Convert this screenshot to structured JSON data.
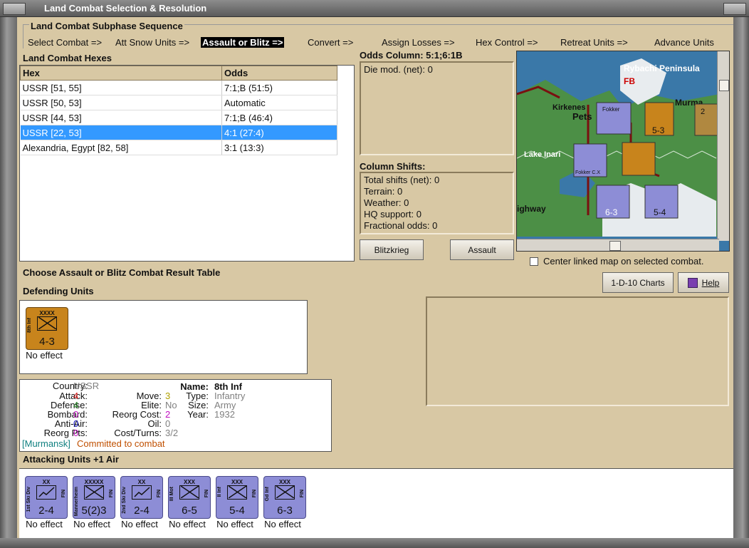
{
  "window": {
    "title": "Land Combat Selection & Resolution"
  },
  "subphase": {
    "heading": "Land Combat Subphase Sequence",
    "steps": [
      "Select Combat =>",
      "Att Snow Units =>",
      "Assault or Blitz =>",
      "Convert =>",
      "Assign Losses =>",
      "Hex Control =>",
      "Retreat Units =>",
      "Advance Units"
    ],
    "active_index": 2
  },
  "hexes": {
    "heading": "Land Combat Hexes",
    "columns": [
      "Hex",
      "Odds"
    ],
    "rows": [
      {
        "hex": "USSR [51, 55]",
        "odds": "7:1;B (51:5)"
      },
      {
        "hex": "USSR [50, 53]",
        "odds": "Automatic"
      },
      {
        "hex": "USSR [44, 53]",
        "odds": "7:1;B (46:4)"
      },
      {
        "hex": "USSR [22, 53]",
        "odds": "4:1 (27:4)"
      },
      {
        "hex": "Alexandria, Egypt [82, 58]",
        "odds": "3:1 (13:3)"
      }
    ],
    "selected_index": 3
  },
  "odds": {
    "heading": "Odds Column: 5:1;6:1B",
    "die_mod": "Die mod. (net): 0"
  },
  "shifts": {
    "heading": "Column Shifts:",
    "lines": [
      "Total shifts (net): 0",
      "Terrain: 0",
      "Weather: 0",
      "HQ support: 0",
      "Fractional odds: 0"
    ]
  },
  "buttons": {
    "blitzkrieg": "Blitzkrieg",
    "assault": "Assault",
    "charts": "1-D-10 Charts",
    "help": "Help"
  },
  "map": {
    "labels": [
      "Rybachi Peninsula",
      "Kirkenes",
      "Pets",
      "Murma",
      "Lake Inari",
      "ighway",
      "FB"
    ],
    "counters": [
      "5-3",
      "6-3",
      "5-4",
      "2"
    ],
    "air": [
      "Fokker",
      "Fokker C.X"
    ],
    "center_linked_label": "Center linked map on selected combat.",
    "center_linked_checked": false
  },
  "choose_label": "Choose Assault or Blitz Combat Result Table",
  "defending": {
    "heading": "Defending Units",
    "units": [
      {
        "side_label": "8th Inf",
        "size": "XXXX",
        "strength": "4-3",
        "effect": "No effect"
      }
    ]
  },
  "unit_info": {
    "country_label": "Country:",
    "country": "USSR",
    "attack_label": "Attack:",
    "attack": "4",
    "defense_label": "Defense:",
    "defense": "4",
    "bombard_label": "Bombard:",
    "bombard": "0",
    "antiair_label": "Anti-Air:",
    "antiair": "0",
    "reorg_pts_label": "Reorg Pts:",
    "reorg_pts": "0",
    "move_label": "Move:",
    "move": "3",
    "elite_label": "Elite:",
    "elite": "No",
    "reorg_cost_label": "Reorg Cost:",
    "reorg_cost": "2",
    "oil_label": "Oil:",
    "oil": "0",
    "cost_turns_label": "Cost/Turns:",
    "cost_turns": "3/2",
    "name_label": "Name:",
    "name": "8th  Inf",
    "type_label": "Type:",
    "type": "Infantry",
    "size_label": "Size:",
    "size": "Army",
    "year_label": "Year:",
    "year": "1932",
    "location": "[Murmansk]",
    "status": "Committed to combat"
  },
  "attacking": {
    "heading": "Attacking Units +1 Air",
    "units": [
      {
        "side_label": "1st Ski Div",
        "size": "XX",
        "strength": "2-4",
        "effect": "No effect"
      },
      {
        "side_label": "Mannerheim",
        "size": "XXXXX",
        "strength": "5(2)3",
        "effect": "No effect"
      },
      {
        "side_label": "2nd Ski Div",
        "size": "XX",
        "strength": "2-4",
        "effect": "No effect"
      },
      {
        "side_label": "III Mot",
        "size": "XXX",
        "strength": "6-5",
        "effect": "No effect"
      },
      {
        "side_label": "II Inf",
        "size": "XXX",
        "strength": "5-4",
        "effect": "No effect"
      },
      {
        "side_label": "Gd Inf",
        "size": "XXX",
        "strength": "6-3",
        "effect": "No effect"
      }
    ],
    "nationality": "FIN"
  },
  "colors": {
    "selected_row": "#3399ff",
    "finnish": "#8d8dd6",
    "soviet": "#c8841c",
    "red_value": "#d01010",
    "green_value": "#208020",
    "magenta_value": "#c010c0",
    "blue_value": "#1010c0",
    "orange_status": "#c05000",
    "teal_location": "#108080"
  }
}
